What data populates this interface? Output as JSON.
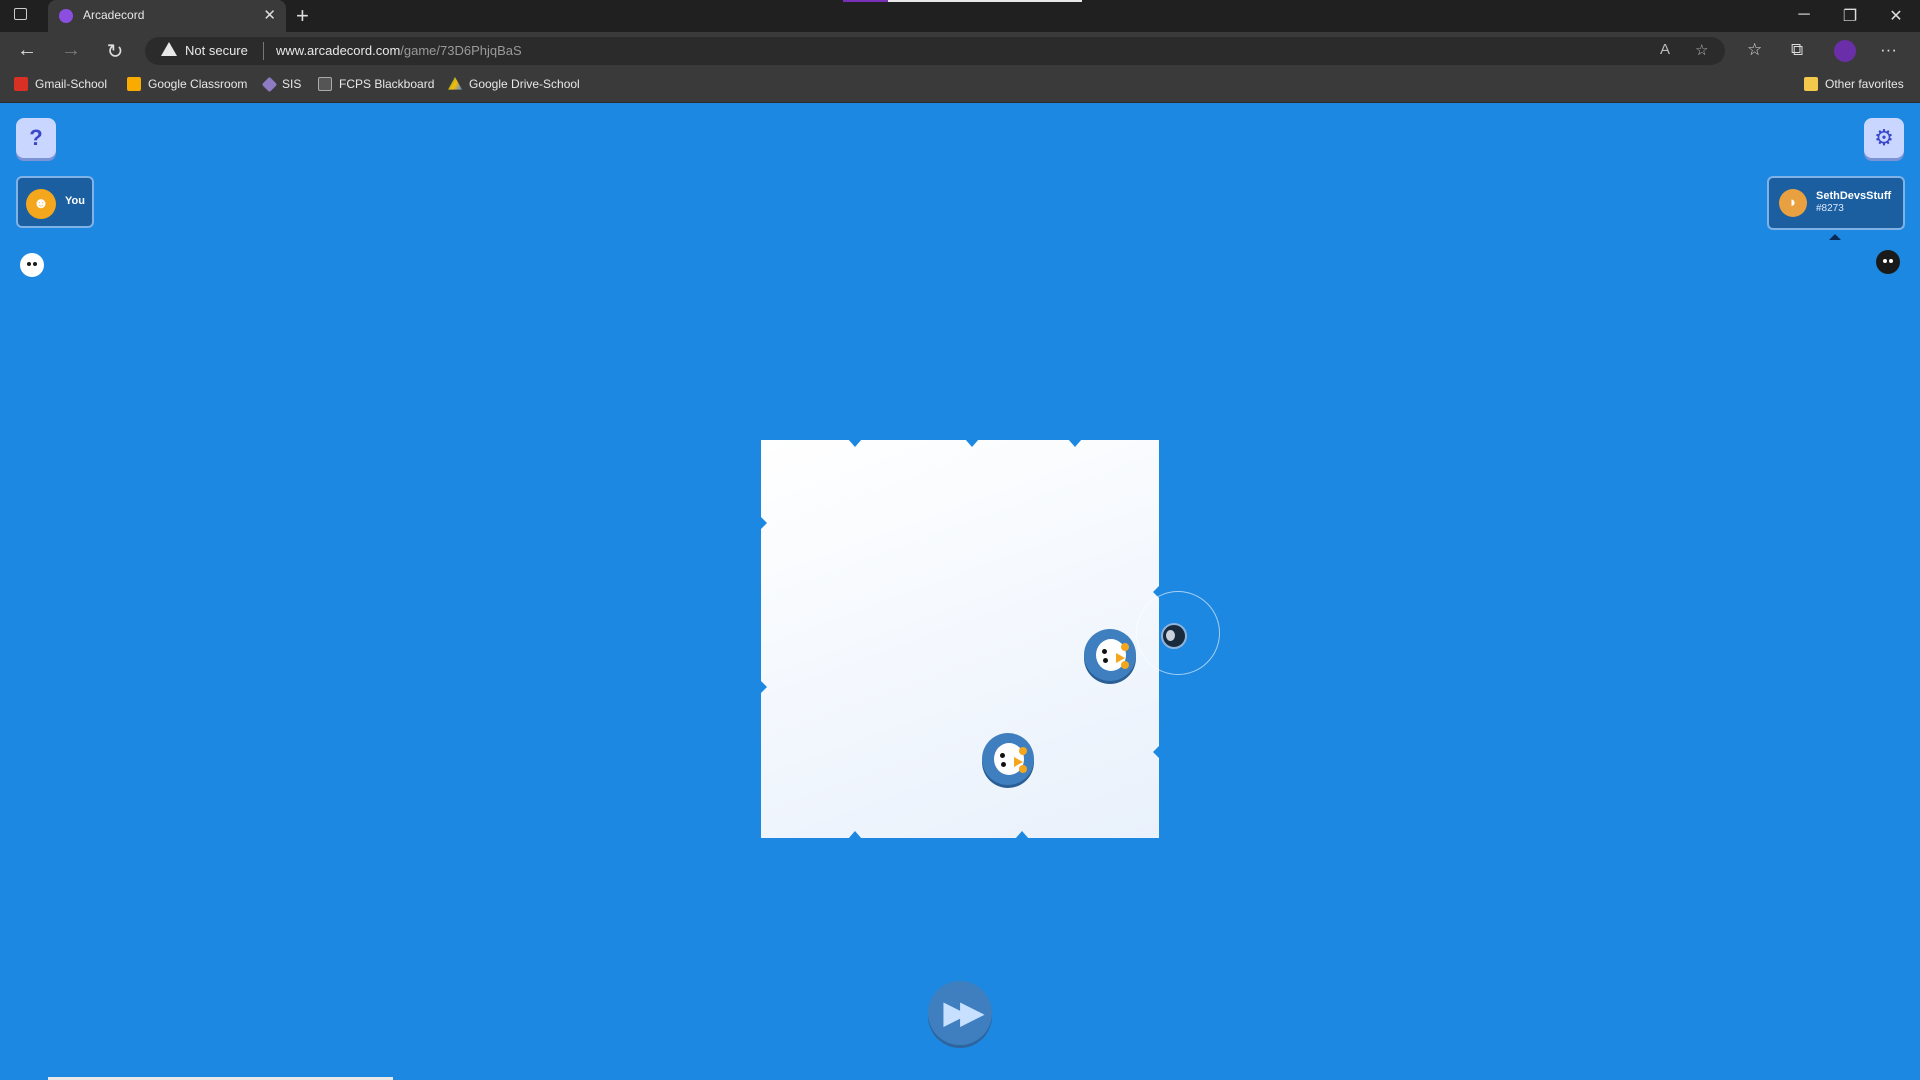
{
  "browser": {
    "tab": {
      "title": "Arcadecord",
      "close": "✕"
    },
    "new_tab": "+",
    "window": {
      "minimize": "─",
      "restore": "❐",
      "close": "✕"
    },
    "nav": {
      "back": "←",
      "forward": "→",
      "reload": "↻"
    },
    "address": {
      "security_label": "Not secure",
      "host": "www.arcadecord.com",
      "path": "/game/73D6PhjqBaS"
    },
    "omnibox_icons": {
      "read_aloud": "A",
      "add_favorite": "☆"
    },
    "toolbar_icons": {
      "favorites": "☆",
      "collections": "⧉",
      "more": "···"
    },
    "bookmarks": [
      {
        "label": "Gmail-School",
        "color": "#d93025"
      },
      {
        "label": "Google Classroom",
        "color": "#f9ab00"
      },
      {
        "label": "SIS",
        "color": "#8e7cc3"
      },
      {
        "label": "FCPS Blackboard",
        "color": "#555555"
      },
      {
        "label": "Google Drive-School",
        "color": "#34a853"
      }
    ],
    "other_favorites": "Other favorites"
  },
  "game": {
    "help_button": "?",
    "settings_button": "⚙",
    "you": {
      "label": "You",
      "avatar": "discord-icon"
    },
    "opponent": {
      "name": "SethDevsStuff",
      "tag": "#8273",
      "avatar": "taco-icon"
    },
    "fast_forward_button": "▶▶",
    "colors": {
      "water": "#1c88e2",
      "ice": "#ffffff",
      "puck": "#3f7fbf",
      "beak": "#f4a61c"
    }
  }
}
